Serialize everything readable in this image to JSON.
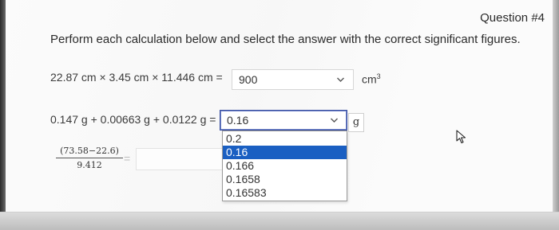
{
  "question": {
    "number_label": "Question #4",
    "instructions": "Perform each calculation below and select the answer with the correct significant figures."
  },
  "problem1": {
    "expression": "22.87 cm × 3.45 cm × 11.446 cm =",
    "selected_value": "900",
    "unit_base": "cm",
    "unit_exponent": "3"
  },
  "problem2": {
    "expression": "0.147 g + 0.00663 g + 0.0122 g =",
    "selected_value": "0.16",
    "unit": "g",
    "options": [
      "0.2",
      "0.16",
      "0.166",
      "0.1658",
      "0.16583"
    ],
    "highlighted_option": "0.16"
  },
  "problem3": {
    "numerator": "(73.58−22.6)",
    "denominator": "9.412",
    "equals": "="
  },
  "icons": {
    "dropdown": "chevron-down-icon",
    "pointer": "mouse-cursor-icon"
  },
  "colors": {
    "highlight": "#1a5fc2",
    "focus_border": "#3a4fa0"
  }
}
